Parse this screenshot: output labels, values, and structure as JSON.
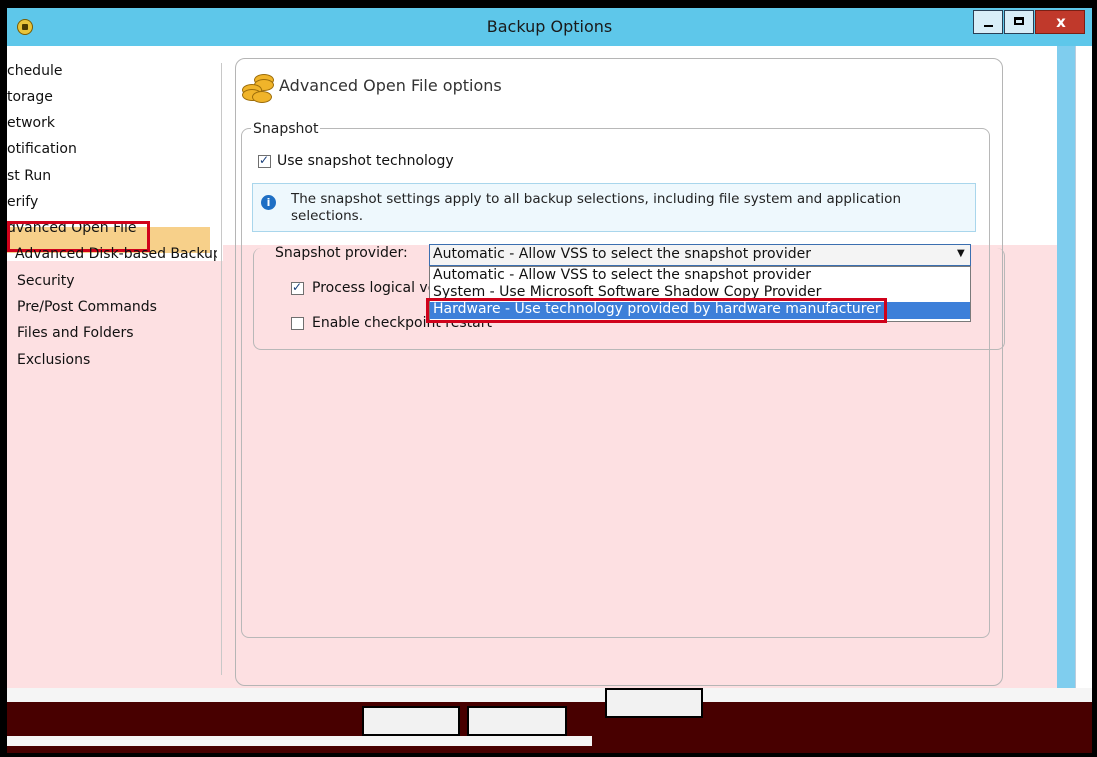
{
  "window": {
    "title": "Backup Options",
    "close_symbol": "x",
    "icon": "backup-exec-icon"
  },
  "nav": {
    "items": [
      {
        "label": "chedule"
      },
      {
        "label": "torage"
      },
      {
        "label": "etwork"
      },
      {
        "label": "otification"
      },
      {
        "label": "st Run"
      },
      {
        "label": "erify"
      },
      {
        "label": "dvanced Open File"
      },
      {
        "label": "Advanced Disk-based Backup"
      },
      {
        "label": "Security"
      },
      {
        "label": "Pre/Post Commands"
      },
      {
        "label": "Files and Folders"
      },
      {
        "label": "Exclusions"
      }
    ]
  },
  "panel": {
    "title": "Advanced Open File options",
    "icon": "coins-icon"
  },
  "snapshot": {
    "group_label": "Snapshot",
    "use_snapshot_label": "Use snapshot technology",
    "use_snapshot_checked": true,
    "info_text": "The snapshot settings apply to all backup selections, including file system and application selections.",
    "provider_label": "Snapshot provider:",
    "provider_value": "Automatic - Allow VSS to select the snapshot provider",
    "provider_options": [
      "Automatic - Allow VSS to select the snapshot provider",
      "System - Use Microsoft Software Shadow Copy Provider",
      "Hardware - Use technology provided by hardware manufacturer"
    ],
    "highlighted_option_index": 2,
    "process_label": "Process logical vo",
    "process_checked": true,
    "checkpoint_label": "Enable checkpoint restart",
    "checkpoint_checked": false
  },
  "colors": {
    "titlebar": "#5ec7ea",
    "highlight_border": "#d0021b",
    "selection": "#3d7fd9",
    "nav_active": "#f7d08a"
  }
}
